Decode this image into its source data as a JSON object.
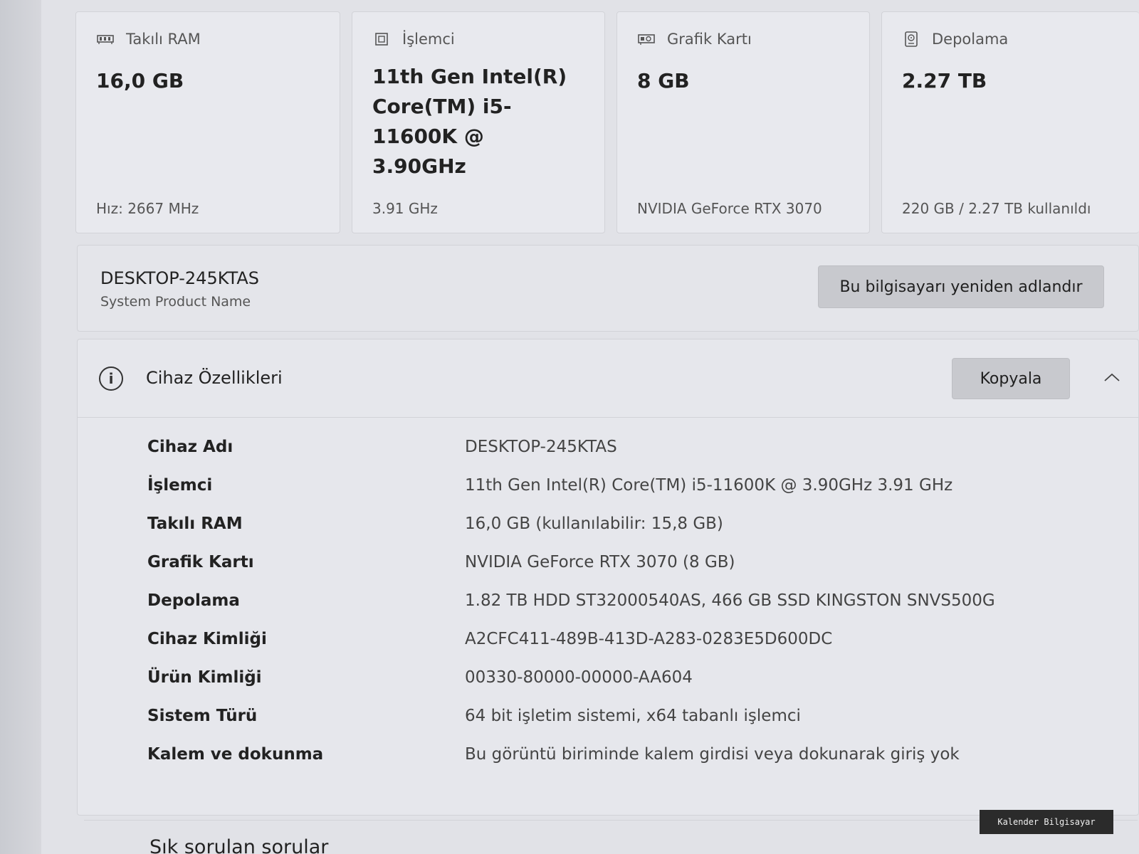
{
  "cards": [
    {
      "icon": "ram-icon",
      "title": "Takılı RAM",
      "value": "16,0 GB",
      "footer": "Hız: 2667 MHz"
    },
    {
      "icon": "processor-icon",
      "title": "İşlemci",
      "value": "11th Gen Intel(R) Core(TM) i5-11600K @ 3.90GHz",
      "footer": "3.91 GHz"
    },
    {
      "icon": "graphics-card-icon",
      "title": "Grafik Kartı",
      "value": "8 GB",
      "footer": "NVIDIA GeForce RTX 3070"
    },
    {
      "icon": "storage-icon",
      "title": "Depolama",
      "value": "2.27 TB",
      "footer": "220 GB / 2.27 TB kullanıldı"
    }
  ],
  "pc": {
    "name": "DESKTOP-245KTAS",
    "model": "System Product Name",
    "rename_label": "Bu bilgisayarı yeniden adlandır"
  },
  "device_specs": {
    "title": "Cihaz Özellikleri",
    "copy_label": "Kopyala",
    "rows": [
      {
        "label": "Cihaz Adı",
        "value": "DESKTOP-245KTAS"
      },
      {
        "label": "İşlemci",
        "value": "11th Gen Intel(R) Core(TM) i5-11600K @ 3.90GHz   3.91 GHz"
      },
      {
        "label": "Takılı RAM",
        "value": "16,0 GB (kullanılabilir: 15,8 GB)"
      },
      {
        "label": "Grafik Kartı",
        "value": "NVIDIA GeForce RTX 3070 (8 GB)"
      },
      {
        "label": "Depolama",
        "value": "1.82 TB HDD ST32000540AS, 466 GB SSD KINGSTON SNVS500G"
      },
      {
        "label": "Cihaz Kimliği",
        "value": "A2CFC411-489B-413D-A283-0283E5D600DC"
      },
      {
        "label": "Ürün Kimliği",
        "value": "00330-80000-00000-AA604"
      },
      {
        "label": "Sistem Türü",
        "value": "64 bit işletim sistemi, x64 tabanlı işlemci"
      },
      {
        "label": "Kalem ve dokunma",
        "value": "Bu görüntü biriminde kalem girdisi veya dokunarak giriş yok"
      }
    ]
  },
  "faq": {
    "title": "Sık sorulan sorular"
  },
  "watermark": "Kalender Bilgisayar"
}
